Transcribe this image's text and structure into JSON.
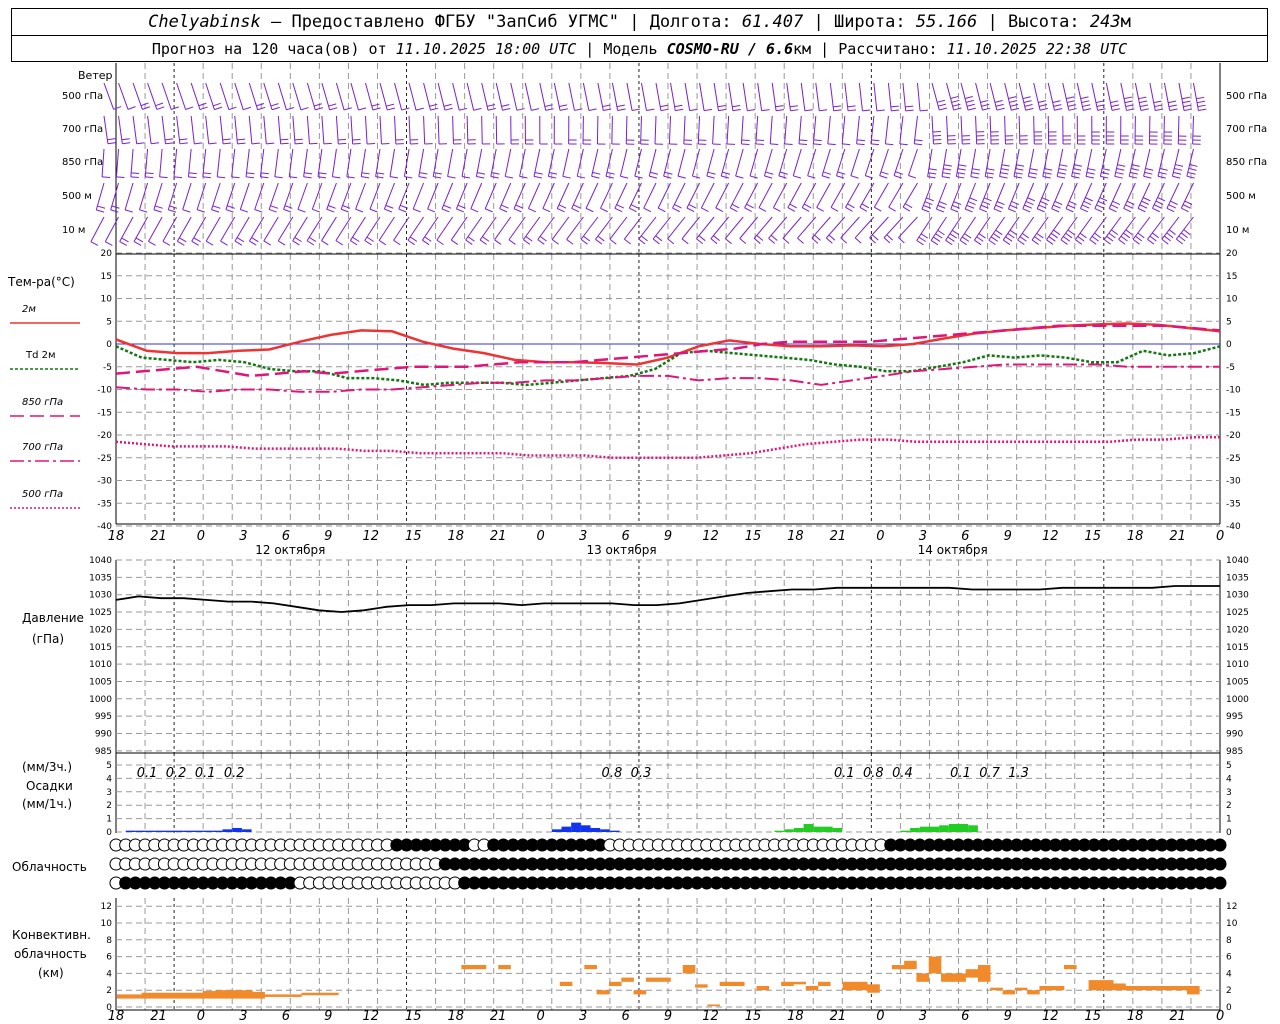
{
  "header": {
    "station": "Chelyabinsk",
    "dash": " — ",
    "provider": "Предоставлено ФГБУ \"ЗапСиб УГМС\"",
    "sep": " | ",
    "lon_label": "Долгота: ",
    "lon": "61.407",
    "lat_label": "Широта: ",
    "lat": "55.166",
    "alt_label": "Высота: ",
    "alt": "243",
    "alt_unit": "м",
    "forecast_prefix": "Прогноз на 120 часа(ов) от ",
    "forecast_time": "11.10.2025 18:00 UTC",
    "model_label": "Модель ",
    "model": "COSMO-RU / 6.6",
    "model_unit": "км",
    "calc_label": "Рассчитано: ",
    "calc_time": "11.10.2025 22:38 UTC"
  },
  "colors": {
    "wind": "#7a1fd1",
    "t2m": "#ee3333",
    "td2m": "#117711",
    "t850": "#e0157a",
    "t700": "#e0157a",
    "t500": "#e0157a",
    "pressure": "#000000",
    "precip_blue": "#1133ee",
    "precip_green": "#22cc22",
    "convective": "#f08a2a",
    "zero_line": "#3333cc",
    "grid": "#999999"
  },
  "chart_data": [
    {
      "type": "wind_barbs",
      "title": "Ветер",
      "levels": [
        "500 гПа",
        "700 гПа",
        "850 гПа",
        "500 м",
        "10 м"
      ],
      "note": "wind barbs every hour at each level; direction mostly W–SW, speeds increasing on 14 октября"
    },
    {
      "type": "line",
      "ylabel": "Тем-ра(°C)",
      "ylim": [
        -40,
        20
      ],
      "yticks": [
        20,
        15,
        10,
        5,
        0,
        -5,
        -10,
        -15,
        -20,
        -25,
        -30,
        -35,
        -40
      ],
      "x_hours": [
        0,
        3,
        6,
        9,
        12,
        15,
        18,
        21,
        24,
        27,
        30,
        33,
        36,
        39,
        42,
        45,
        48,
        51,
        54,
        57,
        60,
        63,
        66,
        69,
        72,
        75,
        78,
        81,
        84,
        87,
        90,
        93,
        96,
        99,
        102,
        105,
        108
      ],
      "series": [
        {
          "name": "2м",
          "values": [
            1,
            -1.5,
            -2,
            -2,
            -1.5,
            -1.2,
            0.5,
            2,
            3,
            2.8,
            0.5,
            -1,
            -2,
            -3.5,
            -4,
            -4,
            -4.2,
            -4.5,
            -3,
            -0.5,
            0.8,
            0,
            -0.5,
            -0.5,
            -0.3,
            -0.5,
            0,
            1.2,
            2.3,
            3,
            3.5,
            4,
            4.3,
            4.5,
            4.2,
            3.5,
            2.8
          ]
        },
        {
          "name": "Td 2м",
          "values": [
            -0.5,
            -3,
            -3.5,
            -4,
            -3.5,
            -4,
            -5.5,
            -6,
            -6,
            -7.5,
            -7.5,
            -8,
            -9,
            -8.5,
            -8.5,
            -8.5,
            -9,
            -8.5,
            -8,
            -7.5,
            -7,
            -5.5,
            -2,
            -1.5,
            -2,
            -2.5,
            -3,
            -3.5,
            -4.5,
            -5,
            -6,
            -6,
            -5,
            -4,
            -2.5,
            -3,
            -2.5,
            -3,
            -4,
            -4,
            -1.5,
            -2.5,
            -2,
            -0.5
          ]
        },
        {
          "name": "850 гПа",
          "values": [
            -6.5,
            -6,
            -5.5,
            -5,
            -6,
            -7,
            -6.5,
            -6,
            -6.5,
            -6,
            -5.5,
            -5,
            -5,
            -5,
            -4.5,
            -4,
            -4,
            -4,
            -3.5,
            -3,
            -2.5,
            -2,
            -1.5,
            -1,
            0,
            0.5,
            0.5,
            0.5,
            0.5,
            1,
            1.5,
            2,
            2.5,
            3,
            3.5,
            4,
            4,
            4,
            4,
            4,
            3.5,
            3
          ]
        },
        {
          "name": "700 гПа",
          "values": [
            -9.5,
            -10,
            -10,
            -10.5,
            -10,
            -10,
            -10.5,
            -10.5,
            -10,
            -10,
            -9.5,
            -9,
            -8.5,
            -8.5,
            -8,
            -8,
            -7.5,
            -7,
            -7,
            -8,
            -7.5,
            -7.5,
            -8,
            -9,
            -8,
            -7,
            -6,
            -5.5,
            -5,
            -4.5,
            -4.5,
            -4.5,
            -4.5,
            -5,
            -5,
            -5,
            -5
          ]
        },
        {
          "name": "500 гПа",
          "values": [
            -21.5,
            -22,
            -22.5,
            -22.5,
            -22.5,
            -23,
            -23,
            -23,
            -23,
            -23.5,
            -23.5,
            -24,
            -24,
            -24,
            -24,
            -24.5,
            -24.5,
            -24.5,
            -25,
            -25,
            -25,
            -25,
            -24.5,
            -24,
            -23,
            -22,
            -21.5,
            -21,
            -21,
            -21.5,
            -21.5,
            -21.5,
            -21.5,
            -21.5,
            -21.5,
            -21.5,
            -21.5,
            -21,
            -21,
            -20.5,
            -20.5
          ]
        }
      ],
      "x_tick_labels": [
        "18",
        "21",
        "0",
        "3",
        "6",
        "9",
        "12",
        "15",
        "18",
        "21",
        "0",
        "3",
        "6",
        "9",
        "12",
        "15",
        "18",
        "21",
        "0",
        "3",
        "6",
        "9",
        "12",
        "15",
        "18",
        "21",
        "0"
      ],
      "dates": [
        "12 октября",
        "13 октября",
        "14 октября"
      ]
    },
    {
      "type": "line",
      "ylabel": "Давление",
      "yunit": "(гПа)",
      "ylim": [
        985,
        1040
      ],
      "yticks": [
        1040,
        1035,
        1030,
        1025,
        1020,
        1015,
        1010,
        1005,
        1000,
        995,
        990,
        985
      ],
      "series": [
        {
          "name": "Давление",
          "values": [
            1028.5,
            1029.5,
            1029,
            1029,
            1028.5,
            1028,
            1028,
            1027.5,
            1026.5,
            1025.5,
            1025,
            1025.5,
            1026.5,
            1027,
            1027,
            1027.5,
            1027.5,
            1027.5,
            1027,
            1027.5,
            1027.5,
            1027.5,
            1027.5,
            1027,
            1027,
            1027.5,
            1028.5,
            1029.5,
            1030.5,
            1031,
            1031.5,
            1031.5,
            1032,
            1032,
            1032,
            1032,
            1032,
            1032,
            1031.5,
            1031.5,
            1031.5,
            1031.5,
            1032,
            1032,
            1032,
            1032,
            1032,
            1032.5,
            1032.5,
            1032.5
          ]
        }
      ]
    },
    {
      "type": "bar",
      "ylabel": "(мм/3ч.)",
      "ylabel2": "Осадки",
      "ylabel3": "(мм/1ч.)",
      "ylim": [
        0,
        5
      ],
      "yticks": [
        5,
        4,
        3,
        2,
        1,
        0
      ],
      "sums_3h": [
        {
          "hour": 3,
          "text": "0.1"
        },
        {
          "hour": 6,
          "text": "0.2"
        },
        {
          "hour": 9,
          "text": "0.1"
        },
        {
          "hour": 12,
          "text": "0.2"
        },
        {
          "hour": 51,
          "text": "0.8"
        },
        {
          "hour": 54,
          "text": "0.3"
        },
        {
          "hour": 75,
          "text": "0.1"
        },
        {
          "hour": 78,
          "text": "0.8"
        },
        {
          "hour": 81,
          "text": "0.4"
        },
        {
          "hour": 87,
          "text": "0.1"
        },
        {
          "hour": 90,
          "text": "0.7"
        },
        {
          "hour": 93,
          "text": "1.3"
        }
      ],
      "hourly_blue": [
        [
          1,
          0.1
        ],
        [
          2,
          0.1
        ],
        [
          3,
          0.1
        ],
        [
          4,
          0.1
        ],
        [
          5,
          0.1
        ],
        [
          6,
          0.1
        ],
        [
          7,
          0.1
        ],
        [
          8,
          0.1
        ],
        [
          9,
          0.1
        ],
        [
          10,
          0.1
        ],
        [
          11,
          0.2
        ],
        [
          12,
          0.3
        ],
        [
          13,
          0.2
        ],
        [
          45,
          0.2
        ],
        [
          46,
          0.4
        ],
        [
          47,
          0.7
        ],
        [
          48,
          0.5
        ],
        [
          49,
          0.3
        ],
        [
          50,
          0.2
        ],
        [
          51,
          0.1
        ]
      ],
      "hourly_green": [
        [
          68,
          0.1
        ],
        [
          69,
          0.2
        ],
        [
          70,
          0.3
        ],
        [
          71,
          0.6
        ],
        [
          72,
          0.4
        ],
        [
          73,
          0.4
        ],
        [
          74,
          0.3
        ],
        [
          81,
          0.1
        ],
        [
          82,
          0.3
        ],
        [
          83,
          0.4
        ],
        [
          84,
          0.4
        ],
        [
          85,
          0.5
        ],
        [
          86,
          0.6
        ],
        [
          87,
          0.6
        ],
        [
          88,
          0.5
        ]
      ]
    },
    {
      "type": "cloud_symbols",
      "ylabel": "Облачность",
      "rows": 3,
      "cover_low_to_high_by_hour": "row1 mostly partial/clear until ~39h then overcast; row2 clear until ~27h then overcast; row3 clear in first 18h overcast from ~1h"
    },
    {
      "type": "bar",
      "ylabel": "Конвективн.",
      "ylabel2": "облачность",
      "ylabel3": "(км)",
      "ylim": [
        0,
        13
      ],
      "yticks": [
        12,
        10,
        8,
        6,
        4,
        2,
        0
      ],
      "layers": [
        {
          "h": 0,
          "base": 1,
          "top": 1.5
        },
        {
          "h": 1,
          "base": 1,
          "top": 1.5
        },
        {
          "h": 2,
          "base": 1,
          "top": 1.7
        },
        {
          "h": 3,
          "base": 1,
          "top": 1.7
        },
        {
          "h": 4,
          "base": 1,
          "top": 1.7
        },
        {
          "h": 5,
          "base": 1,
          "top": 1.7
        },
        {
          "h": 6,
          "base": 1,
          "top": 1.7
        },
        {
          "h": 7,
          "base": 1,
          "top": 1.9
        },
        {
          "h": 8,
          "base": 1,
          "top": 2
        },
        {
          "h": 9,
          "base": 1,
          "top": 2
        },
        {
          "h": 10,
          "base": 1,
          "top": 2
        },
        {
          "h": 11,
          "base": 1,
          "top": 1.8
        },
        {
          "h": 12,
          "base": 1.2,
          "top": 1.5
        },
        {
          "h": 13,
          "base": 1.2,
          "top": 1.5
        },
        {
          "h": 14,
          "base": 1.2,
          "top": 1.5
        },
        {
          "h": 15,
          "base": 1.4,
          "top": 1.7
        },
        {
          "h": 16,
          "base": 1.4,
          "top": 1.7
        },
        {
          "h": 17,
          "base": 1.4,
          "top": 1.7
        },
        {
          "h": 28,
          "base": 4.5,
          "top": 5
        },
        {
          "h": 29,
          "base": 4.5,
          "top": 5
        },
        {
          "h": 31,
          "base": 4.5,
          "top": 5
        },
        {
          "h": 36,
          "base": 2.5,
          "top": 3
        },
        {
          "h": 38,
          "base": 4.5,
          "top": 5
        },
        {
          "h": 39,
          "base": 1.5,
          "top": 2
        },
        {
          "h": 40,
          "base": 2.5,
          "top": 3
        },
        {
          "h": 41,
          "base": 3,
          "top": 3.5
        },
        {
          "h": 42,
          "base": 1.5,
          "top": 2
        },
        {
          "h": 43,
          "base": 3,
          "top": 3.5
        },
        {
          "h": 44,
          "base": 3,
          "top": 3.5
        },
        {
          "h": 46,
          "base": 4,
          "top": 5
        },
        {
          "h": 47,
          "base": 2.3,
          "top": 2.7
        },
        {
          "h": 48,
          "base": 0.1,
          "top": 0.3
        },
        {
          "h": 49,
          "base": 2.5,
          "top": 3
        },
        {
          "h": 50,
          "base": 2.5,
          "top": 3
        },
        {
          "h": 52,
          "base": 2,
          "top": 2.5
        },
        {
          "h": 54,
          "base": 2.5,
          "top": 3
        },
        {
          "h": 55,
          "base": 2.7,
          "top": 3
        },
        {
          "h": 56,
          "base": 2,
          "top": 2.5
        },
        {
          "h": 57,
          "base": 2.5,
          "top": 3
        },
        {
          "h": 59,
          "base": 2,
          "top": 3
        },
        {
          "h": 60,
          "base": 2,
          "top": 3
        },
        {
          "h": 61,
          "base": 1.7,
          "top": 2.7
        },
        {
          "h": 63,
          "base": 4.5,
          "top": 5
        },
        {
          "h": 64,
          "base": 4.5,
          "top": 5.5
        },
        {
          "h": 65,
          "base": 3,
          "top": 4
        },
        {
          "h": 66,
          "base": 4,
          "top": 6
        },
        {
          "h": 67,
          "base": 3,
          "top": 4
        },
        {
          "h": 68,
          "base": 3,
          "top": 4
        },
        {
          "h": 69,
          "base": 3.5,
          "top": 4.5
        },
        {
          "h": 70,
          "base": 3,
          "top": 5
        },
        {
          "h": 71,
          "base": 2,
          "top": 2.3
        },
        {
          "h": 72,
          "base": 1.5,
          "top": 2
        },
        {
          "h": 73,
          "base": 2,
          "top": 2.3
        },
        {
          "h": 74,
          "base": 1.5,
          "top": 2
        },
        {
          "h": 75,
          "base": 2,
          "top": 2.5
        },
        {
          "h": 76,
          "base": 2,
          "top": 2.5
        },
        {
          "h": 77,
          "base": 4.5,
          "top": 5
        },
        {
          "h": 79,
          "base": 2,
          "top": 3.2
        },
        {
          "h": 80,
          "base": 2,
          "top": 3.2
        },
        {
          "h": 81,
          "base": 2,
          "top": 2.8
        },
        {
          "h": 82,
          "base": 2,
          "top": 2.5
        },
        {
          "h": 83,
          "base": 2,
          "top": 2.5
        },
        {
          "h": 84,
          "base": 2,
          "top": 2.5
        },
        {
          "h": 85,
          "base": 2,
          "top": 2.5
        },
        {
          "h": 86,
          "base": 2,
          "top": 2.5
        },
        {
          "h": 87,
          "base": 1.5,
          "top": 2.5
        }
      ]
    }
  ]
}
